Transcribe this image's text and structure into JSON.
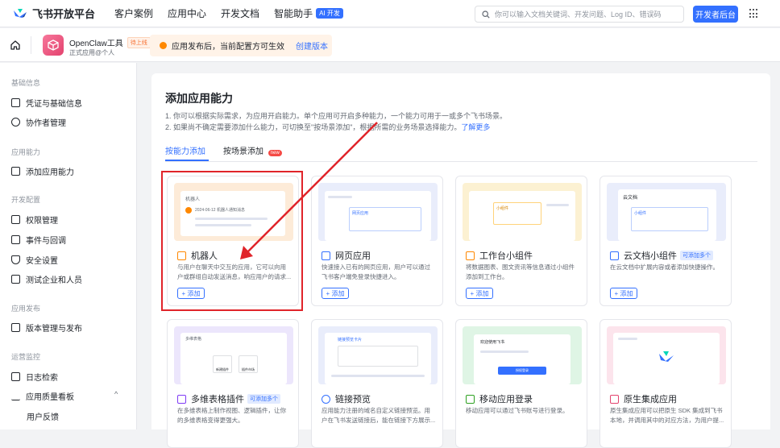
{
  "topnav": {
    "brand": "飞书开放平台",
    "items": [
      "客户案例",
      "应用中心",
      "开发文档",
      "智能助手"
    ],
    "ai_badge": "AI 开发",
    "search_placeholder": "你可以输入文档关键词、开发问题、Log ID、错误码",
    "dev_console": "开发者后台"
  },
  "app": {
    "name": "OpenClaw工具",
    "status": "待上线",
    "subtitle": "正式应用@个人",
    "notice": "应用发布后，当前配置方可生效",
    "notice_link": "创建版本"
  },
  "sidebar": {
    "groups": [
      {
        "title": "基础信息",
        "items": [
          "凭证与基础信息",
          "协作者管理"
        ]
      },
      {
        "title": "应用能力",
        "items": [
          "添加应用能力"
        ]
      },
      {
        "title": "开发配置",
        "items": [
          "权限管理",
          "事件与回调",
          "安全设置",
          "测试企业和人员"
        ]
      },
      {
        "title": "应用发布",
        "items": [
          "版本管理与发布"
        ]
      },
      {
        "title": "运营监控",
        "items": [
          "日志检索",
          "应用质量看板"
        ]
      }
    ],
    "sub_item": "用户反馈",
    "chevron": "^"
  },
  "main": {
    "title": "添加应用能力",
    "desc1": "1. 你可以根据实际需求，为应用开启能力。单个应用可开启多种能力，一个能力可用于一或多个飞书场景。",
    "desc2": "2. 如果尚不确定需要添加什么能力，可切换至\"按场景添加\"，根据所需的业务场景选择能力。",
    "desc2_link": "了解更多",
    "tabs": [
      "按能力添加",
      "按场景添加"
    ],
    "tab_badge": "new",
    "add_label": "+ 添加",
    "cards": [
      {
        "title": "机器人",
        "tag": "",
        "desc": "与用户在聊天中交互的应用，它可以向用户或群组自动发送消息，响应用户的请求..."
      },
      {
        "title": "网页应用",
        "tag": "",
        "desc": "快速接入已有的网页应用，用户可以通过飞书客户端免登录快捷进入。"
      },
      {
        "title": "工作台小组件",
        "tag": "",
        "desc": "将数据图表、图文资讯等信息通过小组件添加到工作台。"
      },
      {
        "title": "云文档小组件",
        "tag": "可添加多个",
        "desc": "在云文档中扩展内容或者添加快捷操作。"
      },
      {
        "title": "多维表格插件",
        "tag": "可添加多个",
        "desc": "在多维表格上制作视图、逻辑插件，让你的多维表格变得更强大。"
      },
      {
        "title": "链接预览",
        "tag": "",
        "desc": "应用能力注册的域名自定义链接预览。用户在飞书发送链接后，能在链接下方展示..."
      },
      {
        "title": "移动应用登录",
        "tag": "",
        "desc": "移动应用可以通过飞书账号进行登录。"
      },
      {
        "title": "原生集成应用",
        "tag": "",
        "desc": "原生集成应用可以把原生 SDK 集成到飞书本地，并调用其中的对应方法，为用户提..."
      }
    ],
    "preview_text": {
      "bot_name": "机器人",
      "bot_sub": "2024-06-12 机器人通知消息",
      "web_item": "网页应用",
      "widget_item": "小组件",
      "doc_title": "云文档",
      "doc_item": "小组件",
      "table_name": "多维表格",
      "table_btn1": "新建插件",
      "table_btn2": "插件市场",
      "link_title": "链接预览卡片",
      "login_title": "欢迎使用飞书",
      "login_btn": "授权登录"
    }
  },
  "colors": {
    "primary": "#3370ff",
    "highlight": "#e0242a",
    "warning": "#ff8800",
    "app_avatar": "#e3426e"
  }
}
